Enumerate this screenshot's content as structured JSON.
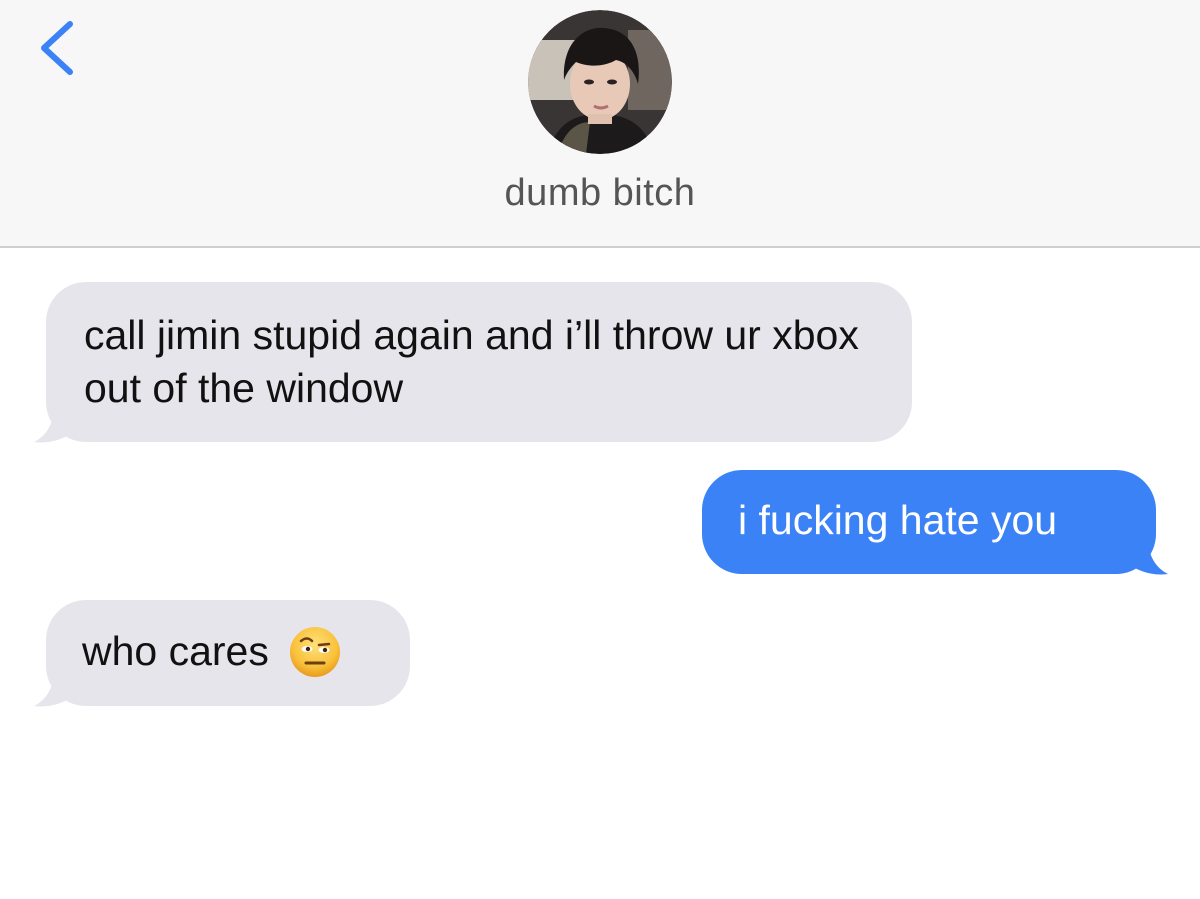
{
  "header": {
    "back_icon": "chevron-left-icon",
    "contact_name": "dumb bitch",
    "avatar_description_icon": "contact-photo"
  },
  "messages": [
    {
      "direction": "received",
      "text": "call jimin stupid again and i’ll throw ur xbox out of the window"
    },
    {
      "direction": "sent",
      "text": "i fucking hate you"
    },
    {
      "direction": "received",
      "text": "who cares",
      "emoji_icon": "face-with-raised-eyebrow-icon"
    }
  ],
  "colors": {
    "accent": "#3b82f6",
    "received_bubble": "#e6e5eb",
    "header_bg": "#f7f7f7"
  }
}
